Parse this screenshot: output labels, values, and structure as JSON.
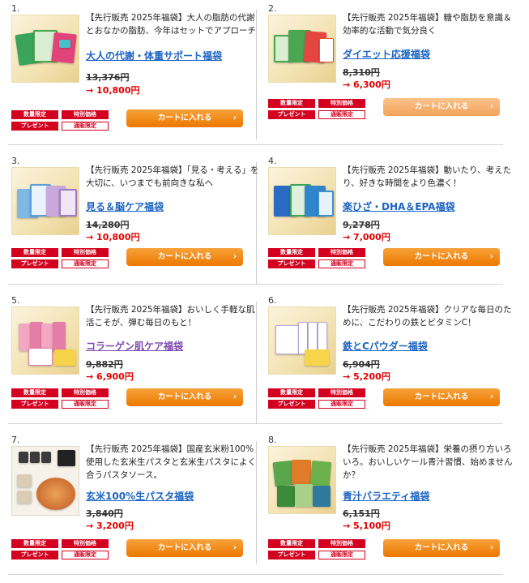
{
  "colors": {
    "accent_orange": "#ec7800",
    "title_blue": "#1c64c2",
    "title_visited": "#7d4ab0",
    "price_red": "#e10000",
    "badge_red": "#d4001f"
  },
  "products": [
    {
      "number": "1.",
      "desc": "【先行販売 2025年福袋】大人の脂肪の代謝とおなかの脂肪、今年はセットでアプローチ",
      "title": "大人の代謝・体重サポート福袋",
      "old_price": "13,376円",
      "new_price": "→ 10,800円",
      "badges": [
        "数量限定",
        "特別価格",
        "プレゼント",
        "通販限定"
      ],
      "cart_label": "カートに入れる",
      "chevron_icon": "chevron-right-icon"
    },
    {
      "number": "2.",
      "desc": "【先行販売 2025年福袋】糖や脂肪を意識＆効率的な活動で気分良く",
      "title": "ダイエット応援福袋",
      "old_price": "8,310円",
      "new_price": "→ 6,300円",
      "badges": [
        "数量限定",
        "特別価格",
        "プレゼント",
        "通販限定"
      ],
      "cart_label": "カートに入れる",
      "chevron_icon": "chevron-right-icon"
    },
    {
      "number": "3.",
      "desc": "【先行販売 2025年福袋】「見る・考える」を大切に、いつまでも前向きな私へ",
      "title": "見る＆脳ケア福袋",
      "old_price": "14,280円",
      "new_price": "→ 10,800円",
      "badges": [
        "数量限定",
        "特別価格",
        "プレゼント",
        "通販限定"
      ],
      "cart_label": "カートに入れる",
      "chevron_icon": "chevron-right-icon"
    },
    {
      "number": "4.",
      "desc": "【先行販売 2025年福袋】動いたり、考えたり、好きな時間をより色濃く！",
      "title": "楽ひざ・DHA＆EPA福袋",
      "old_price": "9,278円",
      "new_price": "→ 7,000円",
      "badges": [
        "数量限定",
        "特別価格",
        "プレゼント",
        "通販限定"
      ],
      "cart_label": "カートに入れる",
      "chevron_icon": "chevron-right-icon"
    },
    {
      "number": "5.",
      "desc": "【先行販売 2025年福袋】おいしく手軽な肌活こそが、弾む毎日のもと！",
      "title": "コラーゲン肌ケア福袋",
      "old_price": "9,882円",
      "new_price": "→ 6,900円",
      "badges": [
        "数量限定",
        "特別価格",
        "プレゼント",
        "通販限定"
      ],
      "cart_label": "カートに入れる",
      "chevron_icon": "chevron-right-icon"
    },
    {
      "number": "6.",
      "desc": "【先行販売 2025年福袋】クリアな毎日のために、こだわりの鉄とビタミンC！",
      "title": "鉄とCパウダー福袋",
      "old_price": "6,904円",
      "new_price": "→ 5,200円",
      "badges": [
        "数量限定",
        "特別価格",
        "プレゼント",
        "通販限定"
      ],
      "cart_label": "カートに入れる",
      "chevron_icon": "chevron-right-icon"
    },
    {
      "number": "7.",
      "desc": "【先行販売 2025年福袋】国産玄米粉100%使用した玄米生パスタと玄米生パスタによく合うパスタソース。",
      "title": "玄米100%生パスタ福袋",
      "old_price": "3,840円",
      "new_price": "→ 3,200円",
      "badges": [
        "数量限定",
        "特別価格",
        "プレゼント",
        "通販限定"
      ],
      "cart_label": "カートに入れる",
      "chevron_icon": "chevron-right-icon"
    },
    {
      "number": "8.",
      "desc": "【先行販売 2025年福袋】栄養の摂り方いろいろ。おいしいケール青汁習慣、始めませんか？",
      "title": "青汁バラエティ福袋",
      "old_price": "6,151円",
      "new_price": "→ 5,100円",
      "badges": [
        "数量限定",
        "特別価格",
        "プレゼント",
        "通販限定"
      ],
      "cart_label": "カートに入れる",
      "chevron_icon": "chevron-right-icon"
    }
  ]
}
